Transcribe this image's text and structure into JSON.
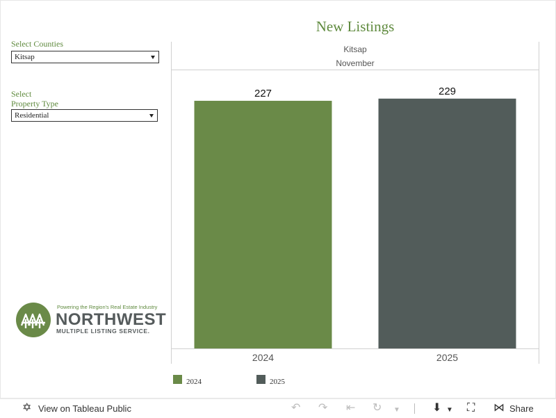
{
  "dashboard": {
    "title": "New Listings"
  },
  "filters": {
    "counties": {
      "label": "Select Counties",
      "value": "Kitsap"
    },
    "property_type": {
      "label_line1": "Select",
      "label_line2": "Property Type",
      "value": "Residential"
    }
  },
  "logo": {
    "tagline": "Powering the Region's Real Estate Industry",
    "name": "NORTHWEST",
    "subtitle": "MULTIPLE LISTING SERVICE."
  },
  "colors": {
    "series_2024": "#6a8a48",
    "series_2025": "#525c5a",
    "brand_green": "#5f8a3e"
  },
  "chart_data": {
    "type": "bar",
    "header_line1": "Kitsap",
    "header_line2": "November",
    "categories": [
      "2024",
      "2025"
    ],
    "values": [
      227,
      229
    ],
    "colors": [
      "#6a8a48",
      "#525c5a"
    ],
    "ylim": [
      0,
      255
    ],
    "grid": false,
    "legend_position": "bottom-left",
    "legend": [
      "2024",
      "2025"
    ]
  },
  "toolbar": {
    "view_label": "View on Tableau Public",
    "share_label": "Share"
  }
}
